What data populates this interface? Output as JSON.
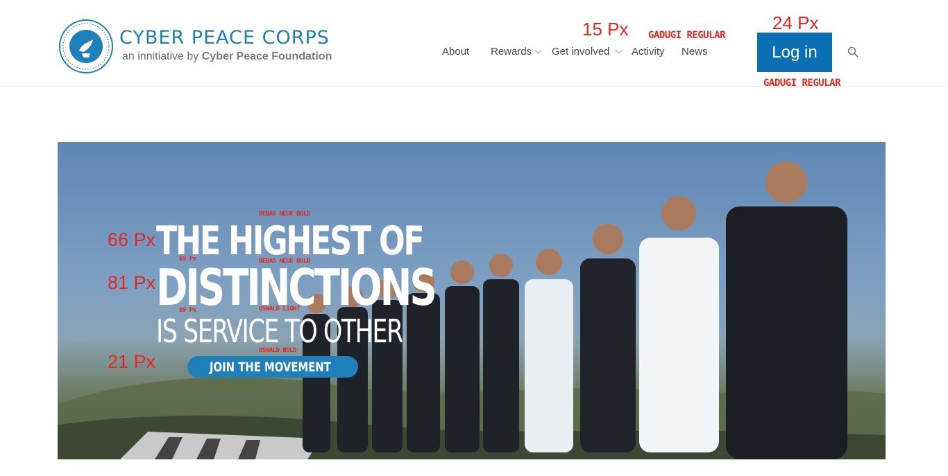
{
  "brand": {
    "badge_text": "CYBER PEACE CORPS",
    "title": "CYBER PEACE CORPS",
    "subtitle_prefix": "an innitiative by",
    "subtitle_org": "Cyber Peace Foundation"
  },
  "nav": {
    "items": [
      "About",
      "Rewards",
      "Get involved",
      "Activity",
      "News"
    ],
    "login_label": "Log in",
    "search_icon": "search-icon"
  },
  "annotations": {
    "nav_size": "15 Px",
    "nav_font": "GADUGI REGULAR",
    "login_size": "24 Px",
    "login_font": "GADUGI REGULAR",
    "hero_line1_size": "66 Px",
    "hero_line2_size": "81 Px",
    "join_size": "21 Px",
    "font_label_1": "BEBAS NEUE BOLD",
    "font_label_2": "BEBAS NEUE BOLD",
    "font_label_3": "OSWALD LIGHT",
    "font_label_4": "OSWALD BOLD",
    "tiny_size_1": "69 Px",
    "tiny_size_2": "69 Px"
  },
  "hero": {
    "line1": "THE HIGHEST OF",
    "line2": "DISTINCTIONS",
    "line3": "IS SERVICE TO OTHER",
    "cta_label": "JOIN THE MOVEMENT"
  },
  "colors": {
    "brand_blue": "#1f7fb8",
    "button_blue": "#0b6fb3",
    "annotation_red": "#e8261f"
  }
}
